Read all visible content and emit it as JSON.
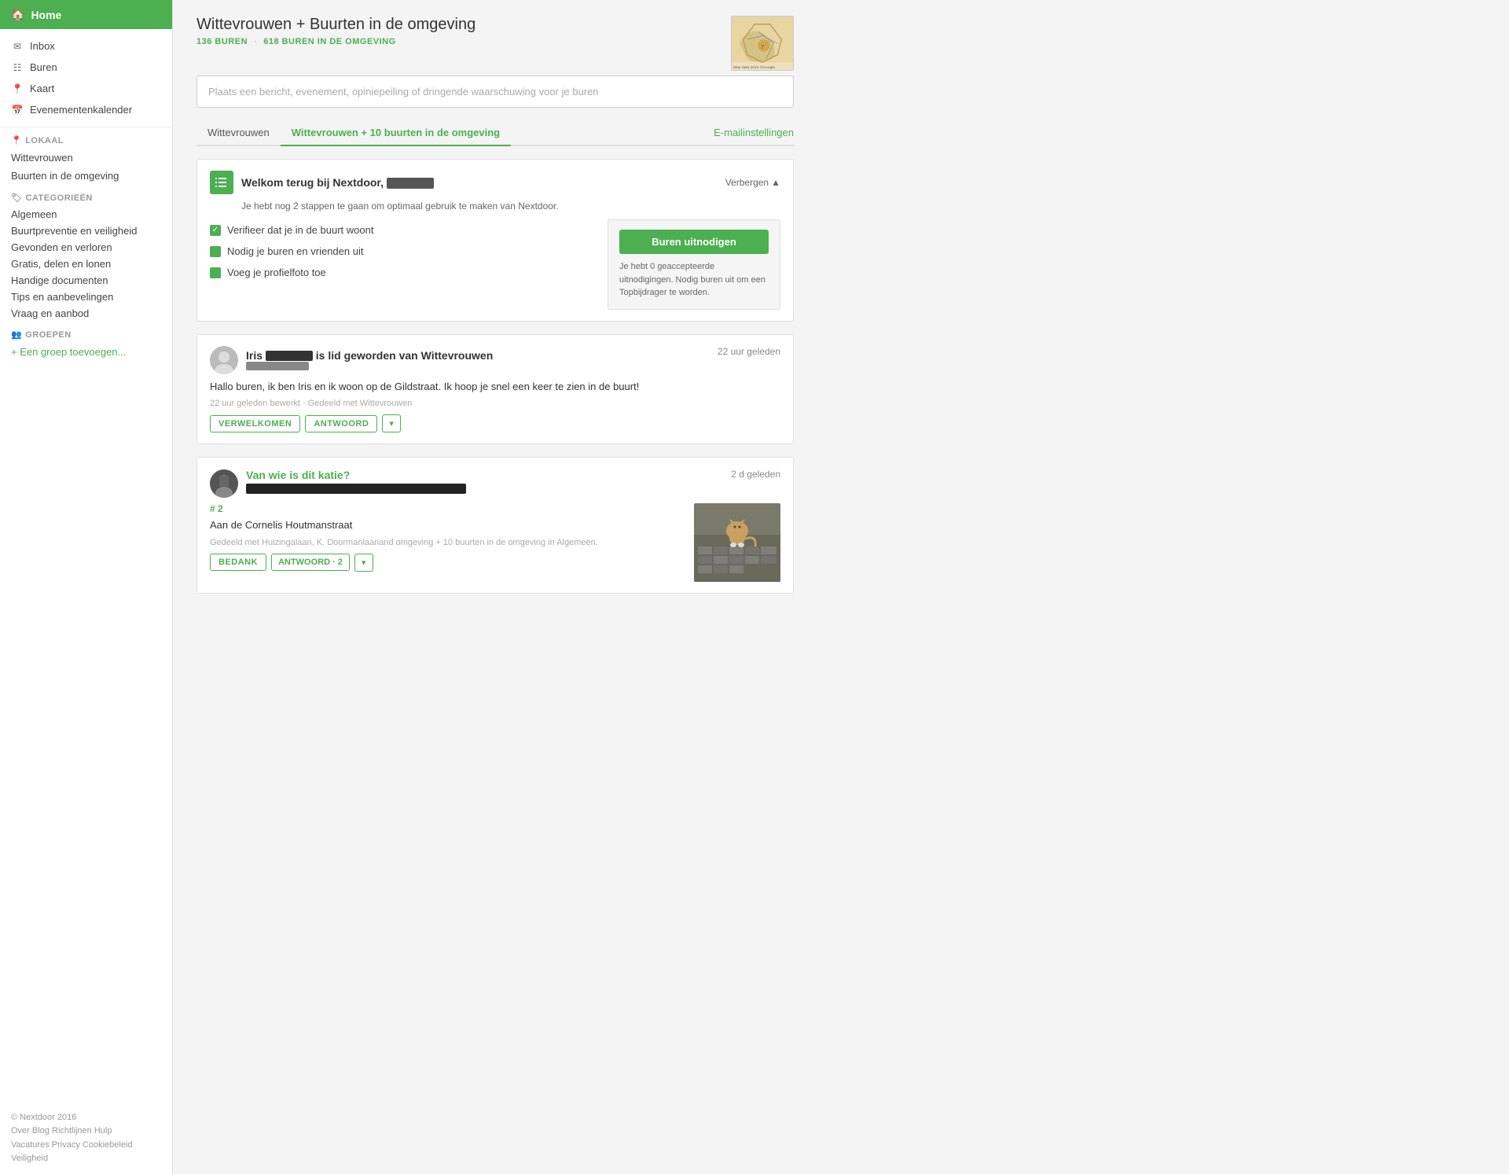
{
  "sidebar": {
    "home_label": "Home",
    "nav_items": [
      {
        "label": "Inbox",
        "icon": "✉"
      },
      {
        "label": "Buren",
        "icon": "☷"
      },
      {
        "label": "Kaart",
        "icon": "📍"
      },
      {
        "label": "Evenementenkalender",
        "icon": "📅"
      }
    ],
    "lokaal_title": "LOKAAL",
    "lokaal_items": [
      "Wittevrouwen",
      "Buurten in de omgeving"
    ],
    "categories_title": "CATEGORIEËN",
    "categories": [
      "Algemeen",
      "Buurtpreventie en veiligheid",
      "Gevonden en verloren",
      "Gratis, delen en lonen",
      "Handige documenten",
      "Tips en aanbevelingen",
      "Vraag en aanbod"
    ],
    "groepen_title": "GROEPEN",
    "add_group": "+ Een groep toevoegen...",
    "footer": {
      "copyright": "© Nextdoor 2016",
      "links": [
        "Over",
        "Blog",
        "Richtlijnen",
        "Hulp",
        "Vacatures",
        "Privacy",
        "Cookiebeleid",
        "Veiligheid"
      ]
    }
  },
  "header": {
    "title": "Wittevrouwen + Buurten in de omgeving",
    "stats_local": "136 BUREN",
    "stats_separator": "·",
    "stats_area": "618 BUREN IN DE OMGEVING"
  },
  "message_placeholder": "Plaats een bericht, evenement, opiniepeiling of dringende waarschuwing voor je buren",
  "tabs": {
    "items": [
      {
        "label": "Wittevrouwen",
        "active": false
      },
      {
        "label": "Wittevrouwen + 10 buurten in de omgeving",
        "active": true
      }
    ],
    "action_label": "E-mailinstellingen"
  },
  "welcome_card": {
    "title_prefix": "Welkom terug bij Nextdoor,",
    "username_placeholder": "██████",
    "subtitle": "Je hebt nog 2 stappen te gaan om optimaal gebruik te maken van Nextdoor.",
    "hide_label": "Verbergen",
    "steps": [
      {
        "text": "Verifieer dat je in de buurt woont",
        "done": true
      },
      {
        "text": "Nodig je buren en vrienden uit",
        "done": false
      },
      {
        "text": "Voeg je profielfoto toe",
        "done": false
      }
    ],
    "invite_btn": "Buren uitnodigen",
    "invite_desc": "Je hebt 0 geaccepteerde uitnodigingen. Nodig buren uit om een Topbijdrager te worden."
  },
  "posts": [
    {
      "id": "post-iris",
      "avatar_type": "circle",
      "title_text": "is lid geworden van Wittevrouwen",
      "name_blurred": true,
      "name_prefix": "Iris",
      "subtitle_blurred": true,
      "time": "22 uur geleden",
      "body": "Hallo buren, ik ben Iris en ik woon op de Gildstraat. Ik hoop je snel een keer te zien in de buurt!",
      "meta": "22 uur geleden bewerkt · Gedeeld met Wittevrouwen",
      "actions": [
        {
          "label": "VERWELKOMEN",
          "type": "primary"
        },
        {
          "label": "ANTWOORD",
          "type": "primary"
        },
        {
          "label": "▾",
          "type": "dropdown"
        }
      ]
    },
    {
      "id": "post-cat",
      "avatar_type": "person",
      "title_text": "Van wie is dit katie?",
      "title_is_link": true,
      "black_bar": true,
      "time": "2 d geleden",
      "number_badge": "# 2",
      "address": "Aan de Cornelis Houtmanstraat",
      "shared": "Gedeeld met Huizingalaan, K. Doormanlaanand omgeving + 10 buurten in de omgeving in Algemeen.",
      "actions": [
        {
          "label": "BEDANK",
          "type": "primary"
        },
        {
          "label": "ANTWOORD",
          "type": "count",
          "count": 2
        },
        {
          "label": "▾",
          "type": "dropdown"
        }
      ]
    }
  ]
}
